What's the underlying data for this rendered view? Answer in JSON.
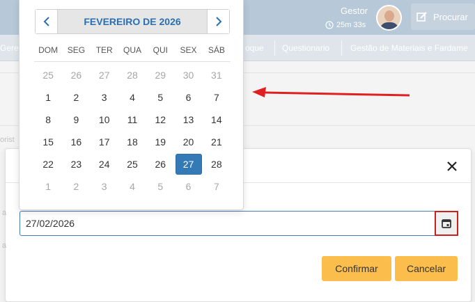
{
  "header": {
    "user_name": "Gestor",
    "timer": "25m 33s",
    "search_label": "Procurar"
  },
  "nav": {
    "items": [
      "Gere",
      "oque",
      "Questionario",
      "Gestão de Materiais e Fardame"
    ]
  },
  "background": {
    "fragment": "orist"
  },
  "modal": {
    "date_value": "27/02/2026",
    "confirm_label": "Confirmar",
    "cancel_label": "Cancelar",
    "left_fragment_1": "a",
    "left_fragment_2": "a"
  },
  "datepicker": {
    "title": "FEVEREIRO DE 2026",
    "weekdays": [
      "DOM",
      "SEG",
      "TER",
      "QUA",
      "QUI",
      "SEX",
      "SÁB"
    ],
    "weeks": [
      [
        "25",
        "26",
        "27",
        "28",
        "29",
        "30",
        "31"
      ],
      [
        "1",
        "2",
        "3",
        "4",
        "5",
        "6",
        "7"
      ],
      [
        "8",
        "9",
        "10",
        "11",
        "12",
        "13",
        "14"
      ],
      [
        "15",
        "16",
        "17",
        "18",
        "19",
        "20",
        "21"
      ],
      [
        "22",
        "23",
        "24",
        "25",
        "26",
        "27",
        "28"
      ],
      [
        "1",
        "2",
        "3",
        "4",
        "5",
        "6",
        "7"
      ]
    ],
    "muted_weeks": [
      0,
      5
    ],
    "selected": {
      "week": 4,
      "day": 5
    }
  },
  "colors": {
    "accent": "#337ab7",
    "button": "#fbbd4c",
    "highlight_border": "#cc2020",
    "arrow": "#e02020"
  }
}
